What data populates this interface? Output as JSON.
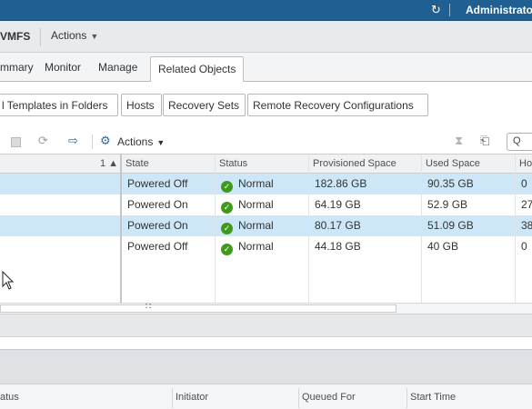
{
  "header": {
    "refresh_icon": "refresh-icon",
    "user": "Administrato"
  },
  "object_bar": {
    "name": "VMFS",
    "actions_label": "Actions"
  },
  "tabs": [
    {
      "label": "mmary"
    },
    {
      "label": "Monitor"
    },
    {
      "label": "Manage"
    },
    {
      "label": "Related Objects",
      "active": true
    }
  ],
  "subtabs": [
    {
      "label": "l Templates in Folders"
    },
    {
      "label": "Hosts"
    },
    {
      "label": "Recovery Sets"
    },
    {
      "label": "Remote Recovery Configurations"
    }
  ],
  "toolbar": {
    "actions_label": "Actions",
    "search_glyph": "Q"
  },
  "grid": {
    "sort_indicator": "1 ▲",
    "columns": [
      "State",
      "Status",
      "Provisioned Space",
      "Used Space",
      "Ho"
    ],
    "rows": [
      {
        "state": "Powered Off",
        "status": "Normal",
        "provisioned": "182.86  GB",
        "used": "90.35  GB",
        "host": "0",
        "selected": true
      },
      {
        "state": "Powered On",
        "status": "Normal",
        "provisioned": "64.19  GB",
        "used": "52.9  GB",
        "host": "27",
        "selected": false
      },
      {
        "state": "Powered On",
        "status": "Normal",
        "provisioned": "80.17  GB",
        "used": "51.09  GB",
        "host": "38",
        "selected": true
      },
      {
        "state": "Powered Off",
        "status": "Normal",
        "provisioned": "44.18  GB",
        "used": "40  GB",
        "host": "0",
        "selected": false
      }
    ]
  },
  "bottom_table": {
    "columns": [
      "atus",
      "Initiator",
      "Queued For",
      "Start Time"
    ]
  },
  "colors": {
    "header_bg": "#1f5f91",
    "selected_row": "#cde7f8",
    "status_ok": "#3f9a1c"
  }
}
